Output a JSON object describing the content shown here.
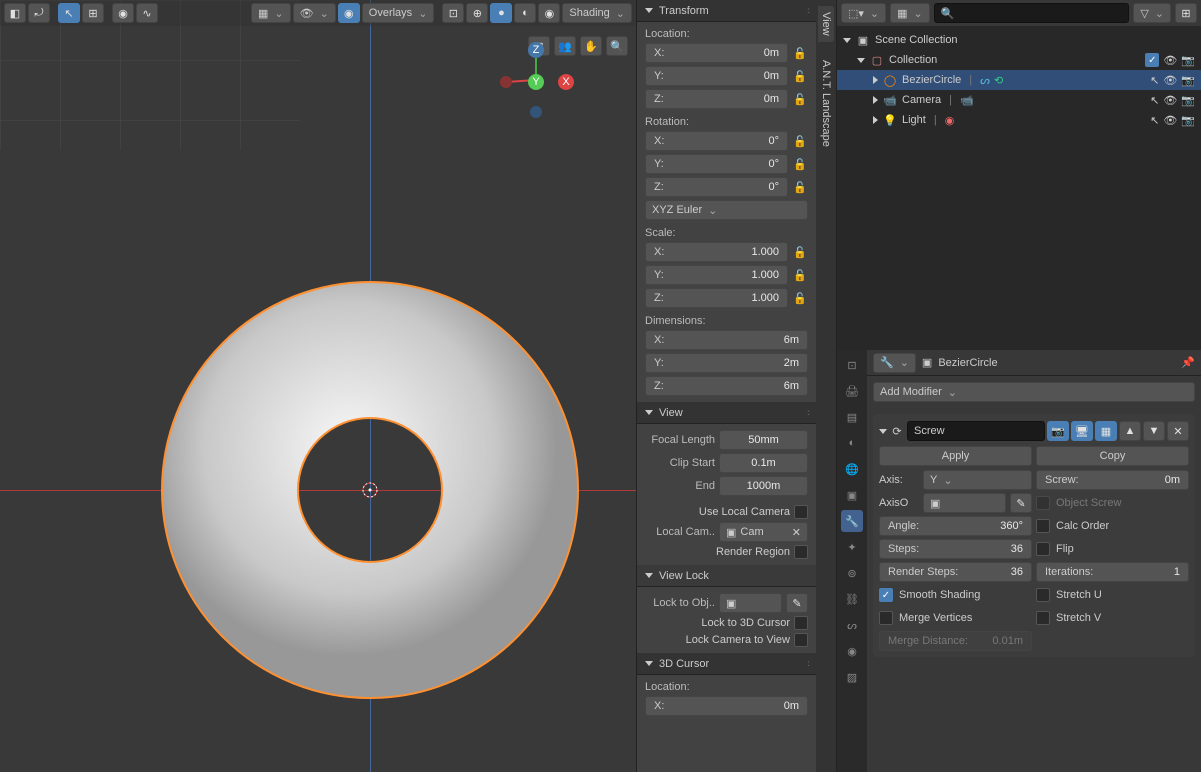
{
  "header": {
    "shading_label": "Shading",
    "overlays_label": "Overlays"
  },
  "outliner": {
    "scene": "Scene Collection",
    "collection": "Collection",
    "items": [
      {
        "name": "BezierCircle"
      },
      {
        "name": "Camera"
      },
      {
        "name": "Light"
      }
    ]
  },
  "transform": {
    "title": "Transform",
    "location_label": "Location:",
    "loc": {
      "x": "0m",
      "y": "0m",
      "z": "0m"
    },
    "rotation_label": "Rotation:",
    "rot": {
      "x": "0°",
      "y": "0°",
      "z": "0°"
    },
    "rot_mode": "XYZ Euler",
    "scale_label": "Scale:",
    "scale": {
      "x": "1.000",
      "y": "1.000",
      "z": "1.000"
    },
    "dimensions_label": "Dimensions:",
    "dim": {
      "x": "6m",
      "y": "2m",
      "z": "6m"
    }
  },
  "view": {
    "title": "View",
    "focal_label": "Focal Length",
    "focal": "50mm",
    "clip_start_label": "Clip Start",
    "clip_start": "0.1m",
    "clip_end_label": "End",
    "clip_end": "1000m",
    "use_local_cam": "Use Local Camera",
    "local_cam_label": "Local Cam..",
    "local_cam_val": "Cam",
    "render_region": "Render Region",
    "viewlock_title": "View Lock",
    "lock_to_obj": "Lock to Obj..",
    "lock_3d": "Lock to 3D Cursor",
    "lock_cam": "Lock Camera to View",
    "cursor_title": "3D Cursor",
    "cursor_loc_label": "Location:",
    "cursor": {
      "x": "0m"
    }
  },
  "tabs": {
    "view": "View",
    "ant": "A.N.T. Landscape"
  },
  "props": {
    "object_name": "BezierCircle",
    "add_modifier": "Add Modifier",
    "mod": {
      "name": "Screw",
      "apply": "Apply",
      "copy": "Copy",
      "axis_label": "Axis:",
      "axis_val": "Y",
      "axis_ob_label": "AxisO",
      "angle_label": "Angle:",
      "angle": "360°",
      "steps_label": "Steps:",
      "steps": "36",
      "rsteps_label": "Render Steps:",
      "rsteps": "36",
      "smooth": "Smooth Shading",
      "merge": "Merge Vertices",
      "merge_dist_label": "Merge Distance:",
      "merge_dist": "0.01m",
      "screw_label": "Screw:",
      "screw": "0m",
      "obj_screw": "Object Screw",
      "calc_order": "Calc Order",
      "flip": "Flip",
      "iter_label": "Iterations:",
      "iter": "1",
      "stretch_u": "Stretch U",
      "stretch_v": "Stretch V"
    }
  },
  "chart_data": {
    "type": "none"
  }
}
